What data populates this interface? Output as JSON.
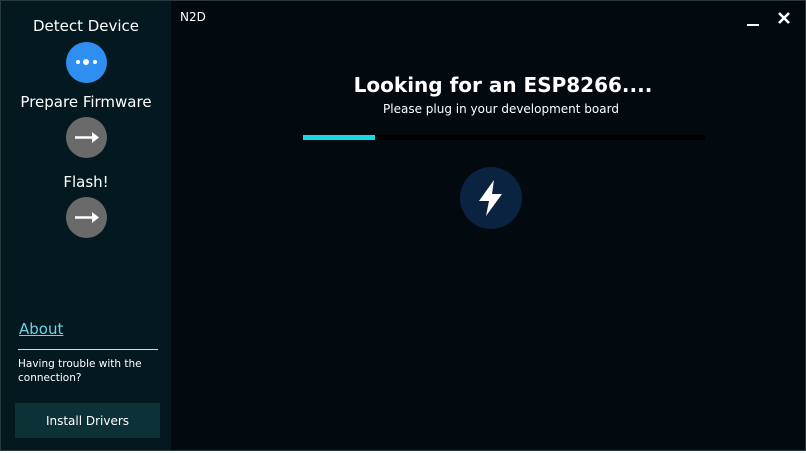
{
  "window": {
    "title": "N2D",
    "minimize_icon": "minimize-icon",
    "close_icon": "close-icon"
  },
  "sidebar": {
    "steps": [
      {
        "label": "Detect Device",
        "icon": "dots-icon",
        "state": "active",
        "color": "#2e8ff0"
      },
      {
        "label": "Prepare Firmware",
        "icon": "arrow-right-icon",
        "state": "pending",
        "color": "#6a6a6a"
      },
      {
        "label": "Flash!",
        "icon": "arrow-right-icon",
        "state": "pending",
        "color": "#6a6a6a"
      }
    ],
    "about_label": "About",
    "trouble_text": "Having trouble with the connection?",
    "install_drivers_label": "Install Drivers"
  },
  "main": {
    "headline": "Looking for an ESP8266....",
    "subline": "Please plug in your development board",
    "progress_fraction": 0.18,
    "progress_color": "#1ad7e6",
    "device_icon": "lightning-bolt-icon"
  },
  "colors": {
    "background": "#020a10",
    "sidebar": "#04191f",
    "link": "#6fd3e8",
    "button": "#0c3237"
  }
}
